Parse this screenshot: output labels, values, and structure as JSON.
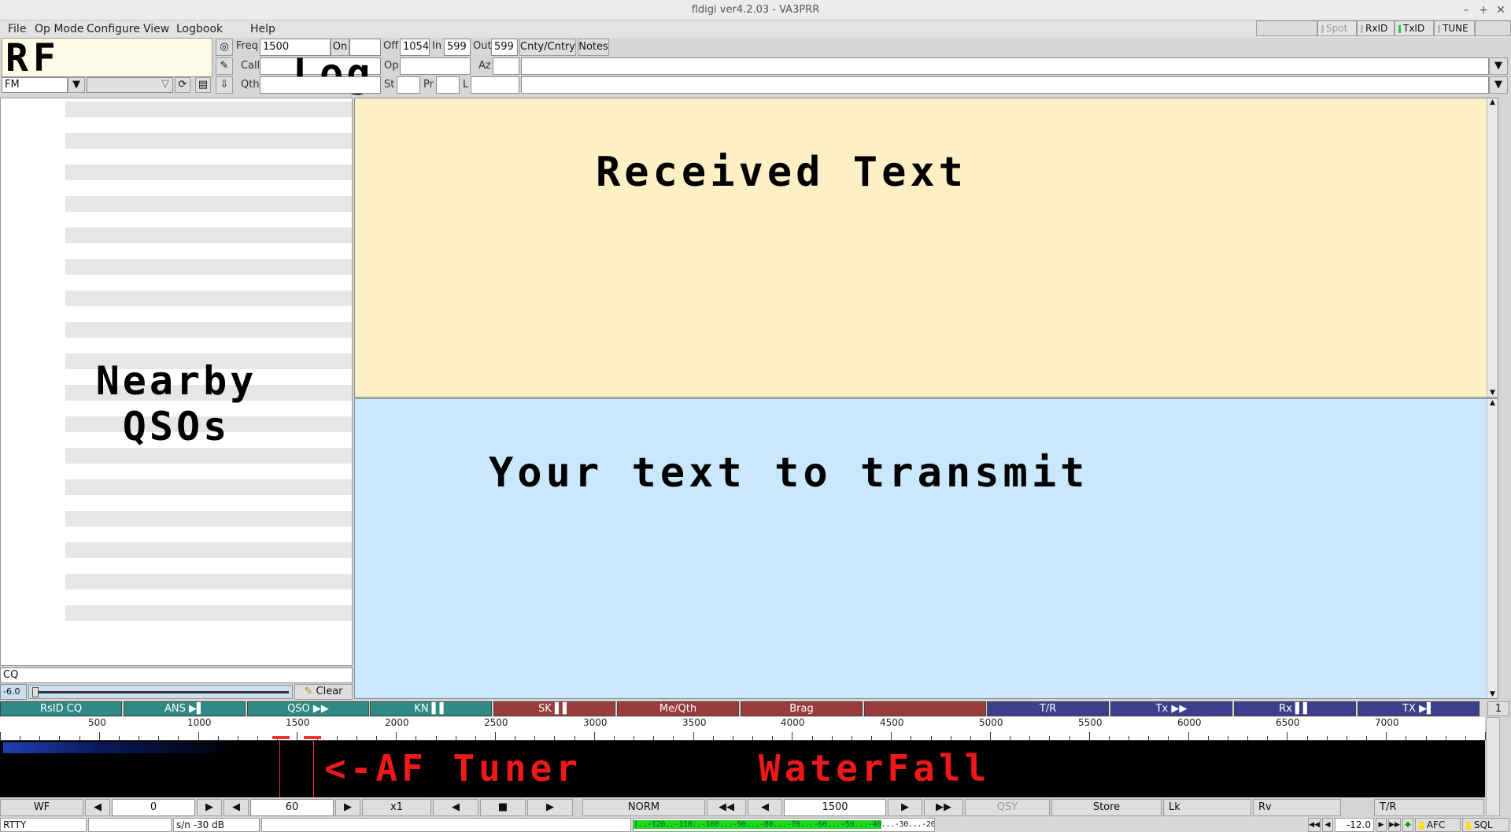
{
  "window": {
    "title": "fldigi ver4.2.03 - VA3PRR"
  },
  "menu": {
    "file": "File",
    "op_mode": "Op Mode",
    "configure": "Configure",
    "view": "View",
    "logbook": "Logbook",
    "help": "Help"
  },
  "toggles": {
    "spot": "Spot",
    "rxid": "RxID",
    "txid": "TxID",
    "tune": "TUNE"
  },
  "overlay": {
    "rf_tuner": "RF Tuner",
    "log": "Log",
    "nearby": "Nearby",
    "qsos": "QSOs",
    "received": "Received Text",
    "transmit": "Your text to transmit",
    "af_tuner": "<-AF Tuner",
    "waterfall": "WaterFall"
  },
  "log": {
    "freq_label": "Freq",
    "freq_value": "1500",
    "on_label": "On",
    "off_label": "Off",
    "off_value": "1054",
    "in_label": "In",
    "in_value": "599",
    "out_label": "Out",
    "out_value": "599",
    "cnty_button": "Cnty/Cntry",
    "notes_button": "Notes",
    "call_label": "Call",
    "op_label": "Op",
    "az_label": "Az",
    "qth_label": "Qth",
    "st_label": "St",
    "pr_label": "Pr",
    "l_label": "L",
    "mode_value": "FM"
  },
  "left": {
    "cq_text": "CQ",
    "squelch_value": "-6.0",
    "clear_button": "Clear"
  },
  "macros": [
    {
      "label": "RsID CQ",
      "color": "#2f8a86"
    },
    {
      "label": "ANS ▶▌",
      "color": "#2f8a86"
    },
    {
      "label": "QSO ▶▶",
      "color": "#2f8a86"
    },
    {
      "label": "KN ▌▌",
      "color": "#2f8a86"
    },
    {
      "label": "SK ▌▌",
      "color": "#9c3b3b"
    },
    {
      "label": "Me/Qth",
      "color": "#9c3b3b"
    },
    {
      "label": "Brag",
      "color": "#9c3b3b"
    },
    {
      "label": "",
      "color": "#9c3b3b"
    },
    {
      "label": "T/R",
      "color": "#3c3f8e"
    },
    {
      "label": "Tx ▶▶",
      "color": "#3c3f8e"
    },
    {
      "label": "Rx ▌▌",
      "color": "#3c3f8e"
    },
    {
      "label": "TX ▶▌",
      "color": "#3c3f8e"
    }
  ],
  "macro_page": "1",
  "scale_ticks": [
    "500",
    "1000",
    "1500",
    "2000",
    "2500",
    "3000",
    "3500",
    "4000",
    "4500",
    "5000",
    "5500",
    "6000",
    "6500",
    "7000"
  ],
  "controls": {
    "wf_button": "WF",
    "ref_value": "0",
    "range_value": "60",
    "zoom_button": "x1",
    "norm_button": "NORM",
    "carrier_value": "1500",
    "qsy_button": "QSY",
    "store_button": "Store",
    "lk_toggle": "Lk",
    "rv_toggle": "Rv",
    "tr_toggle": "T/R"
  },
  "status": {
    "mode": "RTTY",
    "sn": "s/n -30 dB",
    "meter_green": "|..-120..-110..-100...-90...-80...-70...-60...-50...-40",
    "meter_rest": "...-30...-20...-10...|",
    "tx_level": "-12.0",
    "afc": "AFC",
    "sql": "SQL"
  }
}
